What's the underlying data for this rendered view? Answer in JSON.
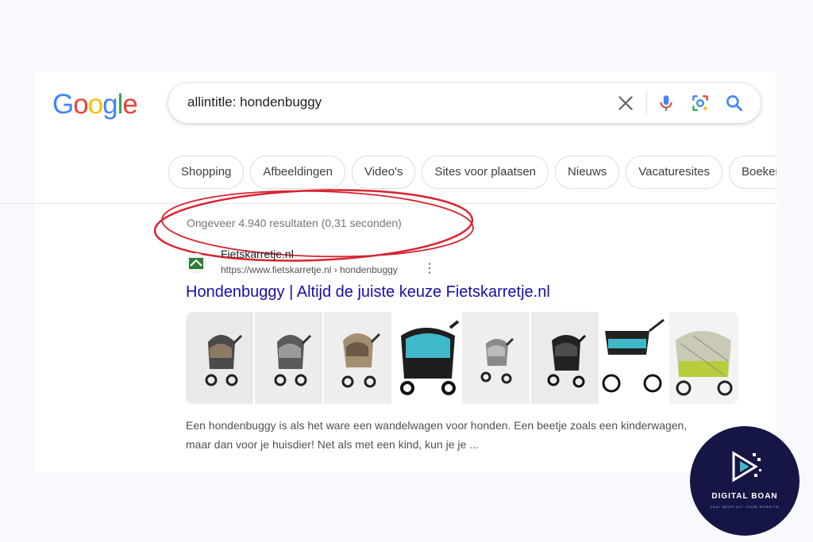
{
  "logo": {
    "letters": [
      "G",
      "o",
      "o",
      "g",
      "l",
      "e"
    ],
    "colors": [
      "#4285f4",
      "#ea4335",
      "#fbbc05",
      "#4285f4",
      "#34a853",
      "#ea4335"
    ]
  },
  "search": {
    "query": "allintitle: hondenbuggy",
    "icons": {
      "clear": "close-icon",
      "voice": "microphone-icon",
      "lens": "camera-lens-icon",
      "search": "search-icon"
    }
  },
  "chips": [
    "Shopping",
    "Afbeeldingen",
    "Video's",
    "Sites voor plaatsen",
    "Nieuws",
    "Vacaturesites",
    "Boeken"
  ],
  "stats": "Ongeveer 4.940 resultaten (0,31 seconden)",
  "result": {
    "site_name": "Fietskarretje.nl",
    "url": "https://www.fietskarretje.nl › hondenbuggy",
    "title": "Hondenbuggy | Altijd de juiste keuze Fietskarretje.nl",
    "snippet_line1": "Een hondenbuggy is als het ware een wandelwagen voor honden. Een beetje zoals een kinderwagen,",
    "snippet_line2": "maar dan voor je huisdier! Net als met een kind, kun je je ..."
  },
  "badge": {
    "name": "DIGITAL BOAN",
    "tagline": "ZAAI MEER UIT JOUW WEBSITE"
  },
  "colors": {
    "link": "#1a0dab",
    "annotation": "#d9232f",
    "badge_bg": "#151546"
  }
}
